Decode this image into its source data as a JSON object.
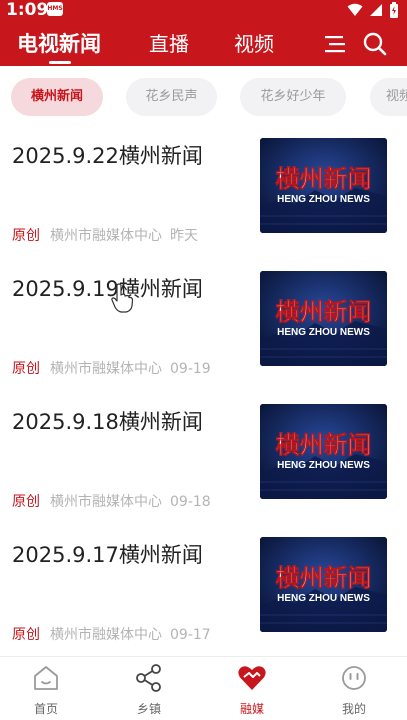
{
  "status_bar": {
    "time": "1:09",
    "badge": "HMS"
  },
  "header": {
    "tabs": [
      {
        "label": "电视新闻",
        "active": true
      },
      {
        "label": "直播",
        "active": false
      },
      {
        "label": "视频",
        "active": false
      }
    ],
    "icons": [
      "menu-icon",
      "search-icon"
    ]
  },
  "channels": [
    {
      "label": "横州新闻",
      "active": true
    },
    {
      "label": "花乡民声",
      "active": false
    },
    {
      "label": "花乡好少年",
      "active": false
    },
    {
      "label": "视频",
      "active": false
    }
  ],
  "news": [
    {
      "title": "2025.9.22横州新闻",
      "origin": "原创",
      "source": "横州市融媒体中心",
      "date": "昨天",
      "thumb_title": "横州新闻",
      "thumb_subtitle": "HENG ZHOU NEWS"
    },
    {
      "title": "2025.9.19横州新闻",
      "origin": "原创",
      "source": "横州市融媒体中心",
      "date": "09-19",
      "thumb_title": "横州新闻",
      "thumb_subtitle": "HENG ZHOU NEWS"
    },
    {
      "title": "2025.9.18横州新闻",
      "origin": "原创",
      "source": "横州市融媒体中心",
      "date": "09-18",
      "thumb_title": "横州新闻",
      "thumb_subtitle": "HENG ZHOU NEWS"
    },
    {
      "title": "2025.9.17横州新闻",
      "origin": "原创",
      "source": "横州市融媒体中心",
      "date": "09-17",
      "thumb_title": "横州新闻",
      "thumb_subtitle": "HENG ZHOU NEWS"
    }
  ],
  "bottom_nav": [
    {
      "label": "首页",
      "icon": "home-icon",
      "active": false
    },
    {
      "label": "乡镇",
      "icon": "share-icon",
      "active": false
    },
    {
      "label": "融媒",
      "icon": "heart-icon",
      "active": true
    },
    {
      "label": "我的",
      "icon": "smiley-icon",
      "active": false
    }
  ],
  "colors": {
    "brand": "#c8161d",
    "chip_bg": "#f2f2f4",
    "chip_active_bg": "#f6d9dc",
    "meta_gray": "#b4b4b4"
  }
}
